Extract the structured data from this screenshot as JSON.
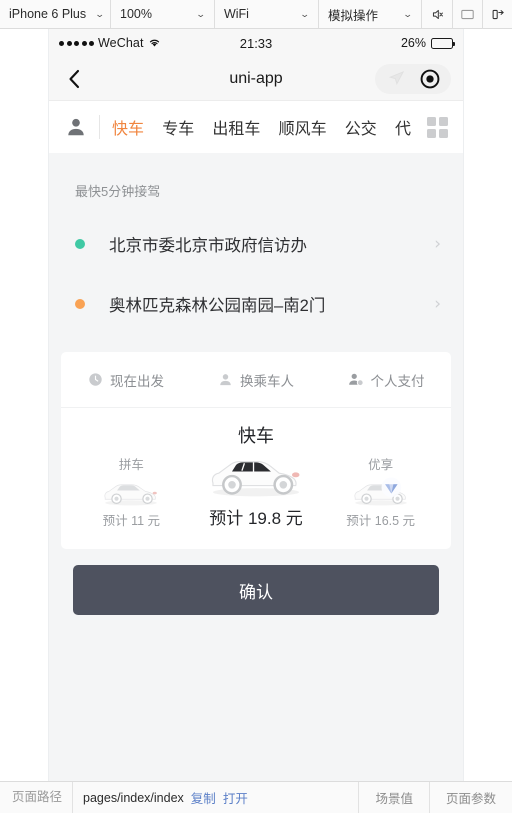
{
  "devtools": {
    "selects": [
      {
        "name": "device",
        "value": "iPhone 6 Plus"
      },
      {
        "name": "zoom",
        "value": "100%"
      },
      {
        "name": "network",
        "value": "WiFi"
      },
      {
        "name": "simulate",
        "value": "模拟操作"
      }
    ],
    "icons": [
      {
        "name": "mute-icon",
        "glyph": "speaker"
      },
      {
        "name": "display-icon",
        "glyph": "monitor"
      },
      {
        "name": "detach-icon",
        "glyph": "detach"
      }
    ]
  },
  "phone": {
    "status_bar": {
      "carrier": "WeChat",
      "time": "21:33",
      "battery_text": "26%",
      "battery_percent": 26
    },
    "nav": {
      "title": "uni-app",
      "back_icon": "chevron-left-icon",
      "location_icon": "navigation-arrow-icon",
      "target_icon": "target-record-icon"
    },
    "tabs": {
      "avatar_icon": "person-icon",
      "grid_icon": "grid-menu-icon",
      "items": [
        {
          "label": "快车",
          "active": true
        },
        {
          "label": "专车",
          "active": false
        },
        {
          "label": "出租车",
          "active": false
        },
        {
          "label": "顺风车",
          "active": false
        },
        {
          "label": "公交",
          "active": false
        },
        {
          "label": "代",
          "active": false
        }
      ]
    },
    "content": {
      "eta": "最快5分钟接驾",
      "locations": [
        {
          "name": "北京市委北京市政府信访办",
          "dot": "origin",
          "chevron": "›"
        },
        {
          "name": "奥林匹克森林公园南园–南2门",
          "dot": "dest",
          "chevron": "›"
        }
      ],
      "options": [
        {
          "label": "现在出发",
          "icon": "clock-icon"
        },
        {
          "label": "换乘车人",
          "icon": "person-icon"
        },
        {
          "label": "个人支付",
          "icon": "person-pay-icon"
        }
      ],
      "cars": [
        {
          "label": "拼车",
          "price": "预计 11 元",
          "active": false,
          "badge": false
        },
        {
          "label": "快车",
          "price": "预计 19.8 元",
          "active": true,
          "badge": false
        },
        {
          "label": "优享",
          "price": "预计 16.5 元",
          "active": false,
          "badge": true
        }
      ],
      "confirm_label": "确认"
    }
  },
  "bottom_bar": {
    "path_label": "页面路径",
    "path_value": "pages/index/index",
    "copy_label": "复制",
    "open_label": "打开",
    "scene_label": "场景值",
    "params_label": "页面参数"
  },
  "colors": {
    "accent_orange": "#f0853f",
    "origin_dot": "#3fc9a4",
    "dest_dot": "#f9a254",
    "confirm_bg": "#4e525f",
    "link_blue": "#5b7fc7"
  }
}
